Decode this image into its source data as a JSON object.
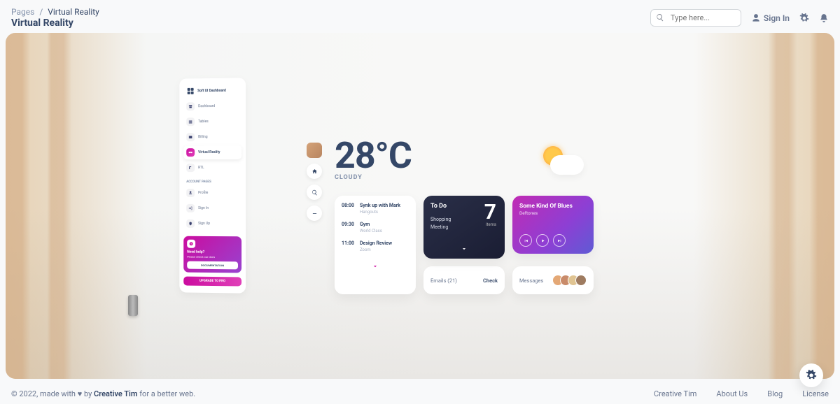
{
  "header": {
    "breadcrumb_root": "Pages",
    "breadcrumb_sep": "/",
    "breadcrumb_current": "Virtual Reality",
    "title": "Virtual Reality",
    "search_placeholder": "Type here...",
    "signin": "Sign In"
  },
  "sidebar": {
    "brand": "Soft UI Dashboard",
    "items": [
      {
        "label": "Dashboard",
        "icon": "shop-icon"
      },
      {
        "label": "Tables",
        "icon": "tables-icon"
      },
      {
        "label": "Billing",
        "icon": "billing-icon"
      },
      {
        "label": "Virtual Reality",
        "icon": "vr-icon"
      },
      {
        "label": "RTL",
        "icon": "rtl-icon"
      }
    ],
    "section_label": "ACCOUNT PAGES",
    "account_items": [
      {
        "label": "Profile",
        "icon": "profile-icon"
      },
      {
        "label": "Sign In",
        "icon": "signin-icon"
      },
      {
        "label": "Sign Up",
        "icon": "signup-icon"
      }
    ],
    "help": {
      "title": "Need help?",
      "subtitle": "Please check our docs",
      "doc_button": "DOCUMENTATION"
    },
    "upgrade": "UPGRADE TO PRO"
  },
  "weather": {
    "temp": "28°C",
    "sky": "CLOUDY"
  },
  "schedule": [
    {
      "time": "08:00",
      "task": "Synk up with Mark",
      "loc": "Hangouts"
    },
    {
      "time": "09:30",
      "task": "Gym",
      "loc": "World Class"
    },
    {
      "time": "11:00",
      "task": "Design Review",
      "loc": "Zoom"
    }
  ],
  "todo": {
    "title": "To Do",
    "count": "7",
    "items_label": "items",
    "list": [
      "Shopping",
      "Meeting"
    ]
  },
  "player": {
    "title": "Some Kind Of Blues",
    "artist": "Deftones"
  },
  "emails": {
    "label": "Emails (21)",
    "action": "Check"
  },
  "messages": {
    "label": "Messages"
  },
  "footer": {
    "copyright_prefix": "© 2022, made with ",
    "copyright_mid": " by ",
    "brand": "Creative Tim",
    "copyright_suffix": " for a better web.",
    "links": [
      "Creative Tim",
      "About Us",
      "Blog",
      "License"
    ]
  }
}
